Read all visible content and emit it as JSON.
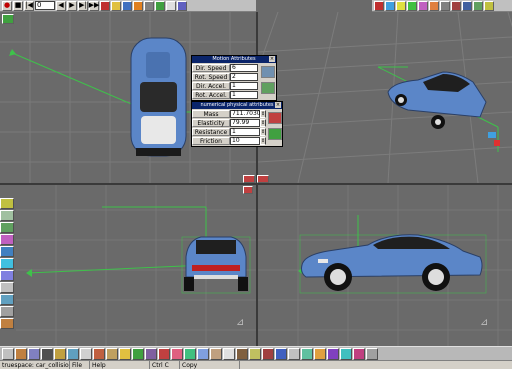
{
  "toolbar_top": {
    "frame_value": "0",
    "buttons": [
      "record",
      "stop",
      "frame-back",
      "frame-forward",
      "play",
      "end"
    ]
  },
  "motion_panel": {
    "title": "Motion Attributes",
    "rows": [
      {
        "label": "Dir. Speed",
        "value": "6"
      },
      {
        "label": "Rot. Speed",
        "value": "2"
      },
      {
        "label": "Dir. Accel.",
        "value": "1"
      },
      {
        "label": "Rot. Accel.",
        "value": "1"
      }
    ]
  },
  "physics_panel": {
    "title": "numerical physical attributes",
    "rows": [
      {
        "label": "Mass",
        "value": "711.70303"
      },
      {
        "label": "Elasticity",
        "value": "79.99"
      },
      {
        "label": "Resistance",
        "value": "1"
      },
      {
        "label": "Friction",
        "value": "10"
      }
    ]
  },
  "statusbar": {
    "file": "truespace: car_collision",
    "file_menu": "File",
    "help_menu": "Help",
    "shortcut": "Ctrl C",
    "action": "Copy"
  },
  "colors": {
    "car_body": "#5b86c8",
    "grid_bg": "#6a6a6a",
    "axis_green": "#3ec24a",
    "panel_title": "#0a246a"
  }
}
